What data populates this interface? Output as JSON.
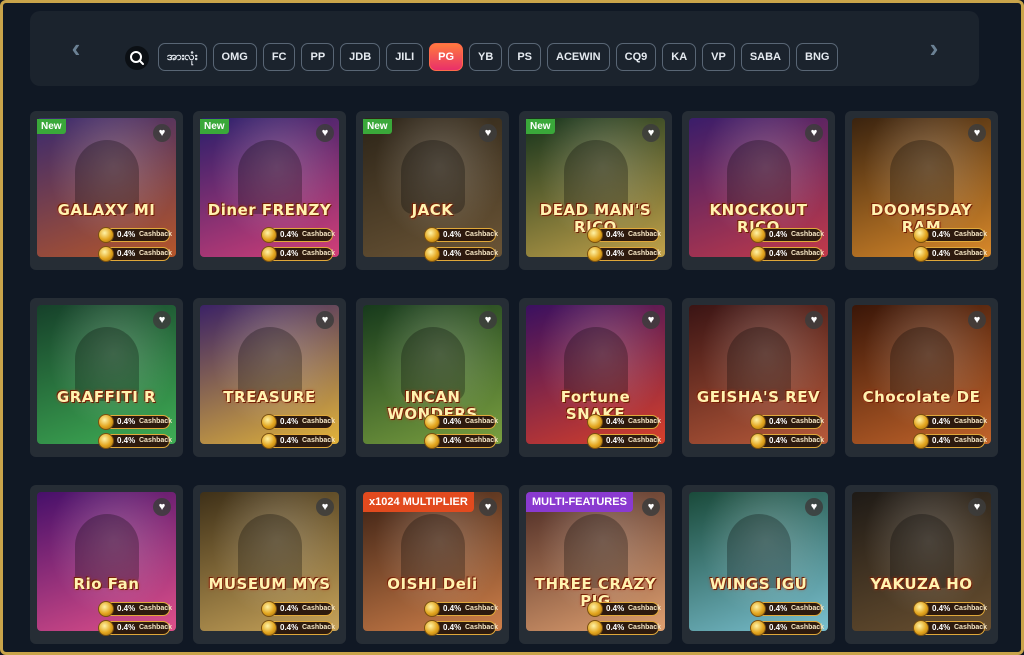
{
  "providers": {
    "search_icon": "search-icon",
    "left_arrow": "‹",
    "right_arrow": "›",
    "items": [
      {
        "label": "အားလုံး",
        "active": false
      },
      {
        "label": "OMG",
        "active": false
      },
      {
        "label": "FC",
        "active": false
      },
      {
        "label": "PP",
        "active": false
      },
      {
        "label": "JDB",
        "active": false
      },
      {
        "label": "JILI",
        "active": false
      },
      {
        "label": "PG",
        "active": true
      },
      {
        "label": "YB",
        "active": false
      },
      {
        "label": "PS",
        "active": false
      },
      {
        "label": "ACEWIN",
        "active": false
      },
      {
        "label": "CQ9",
        "active": false
      },
      {
        "label": "KA",
        "active": false
      },
      {
        "label": "VP",
        "active": false
      },
      {
        "label": "SABA",
        "active": false
      },
      {
        "label": "BNG",
        "active": false
      }
    ]
  },
  "cashback": {
    "percent": "0.4%",
    "label": "Cashback"
  },
  "heart_icon": "♥",
  "games": [
    {
      "title": "GALAXY MI",
      "badge": "New",
      "banner": "",
      "colors": [
        "#3a2a6e",
        "#b5562a"
      ]
    },
    {
      "title": "Diner FRENZY",
      "badge": "New",
      "banner": "",
      "colors": [
        "#2a1f6b",
        "#d23f78"
      ]
    },
    {
      "title": "JACK",
      "badge": "New",
      "banner": "",
      "colors": [
        "#2c2418",
        "#6b5536"
      ]
    },
    {
      "title": "DEAD MAN'S RICO",
      "badge": "New",
      "banner": "",
      "colors": [
        "#15331c",
        "#c2a24a"
      ]
    },
    {
      "title": "KNOCKOUT RICO",
      "badge": "",
      "banner": "",
      "colors": [
        "#3a1d6a",
        "#c23a4a"
      ]
    },
    {
      "title": "DOOMSDAY RAM",
      "badge": "",
      "banner": "",
      "colors": [
        "#3a230f",
        "#d9892a"
      ]
    },
    {
      "title": "GRAFFITI R",
      "badge": "",
      "banner": "",
      "colors": [
        "#16402a",
        "#3fae55"
      ]
    },
    {
      "title": "TREASURE",
      "badge": "",
      "banner": "",
      "colors": [
        "#3b2266",
        "#e2b43a"
      ]
    },
    {
      "title": "INCAN WONDERS",
      "badge": "",
      "banner": "",
      "colors": [
        "#173a1c",
        "#7aa040"
      ]
    },
    {
      "title": "Fortune SNAKE",
      "badge": "",
      "banner": "",
      "colors": [
        "#3a1060",
        "#d8402a"
      ]
    },
    {
      "title": "GEISHA'S REV",
      "badge": "",
      "banner": "",
      "colors": [
        "#3a1414",
        "#b85a3a"
      ]
    },
    {
      "title": "Chocolate DE",
      "badge": "",
      "banner": "",
      "colors": [
        "#3a1608",
        "#c2642a"
      ]
    },
    {
      "title": "Rio Fan",
      "badge": "",
      "banner": "",
      "colors": [
        "#46106a",
        "#e0508a"
      ]
    },
    {
      "title": "MUSEUM MYS",
      "badge": "",
      "banner": "",
      "colors": [
        "#3e3018",
        "#c8a45a"
      ]
    },
    {
      "title": "OISHI Deli",
      "badge": "",
      "banner": "x1024 MULTIPLIER",
      "banner_color": "#e24a1e",
      "colors": [
        "#3a2014",
        "#d0804a"
      ]
    },
    {
      "title": "THREE CRAZY PIG",
      "badge": "",
      "banner": "MULTI-FEATURES",
      "banner_color": "#8a3ad0",
      "colors": [
        "#4a2a24",
        "#e0a070"
      ]
    },
    {
      "title": "WINGS IGU",
      "badge": "",
      "banner": "",
      "colors": [
        "#1a4a3a",
        "#7ac0d0"
      ]
    },
    {
      "title": "YAKUZA HO",
      "badge": "",
      "banner": "",
      "colors": [
        "#1e1a16",
        "#6a5030"
      ]
    }
  ]
}
